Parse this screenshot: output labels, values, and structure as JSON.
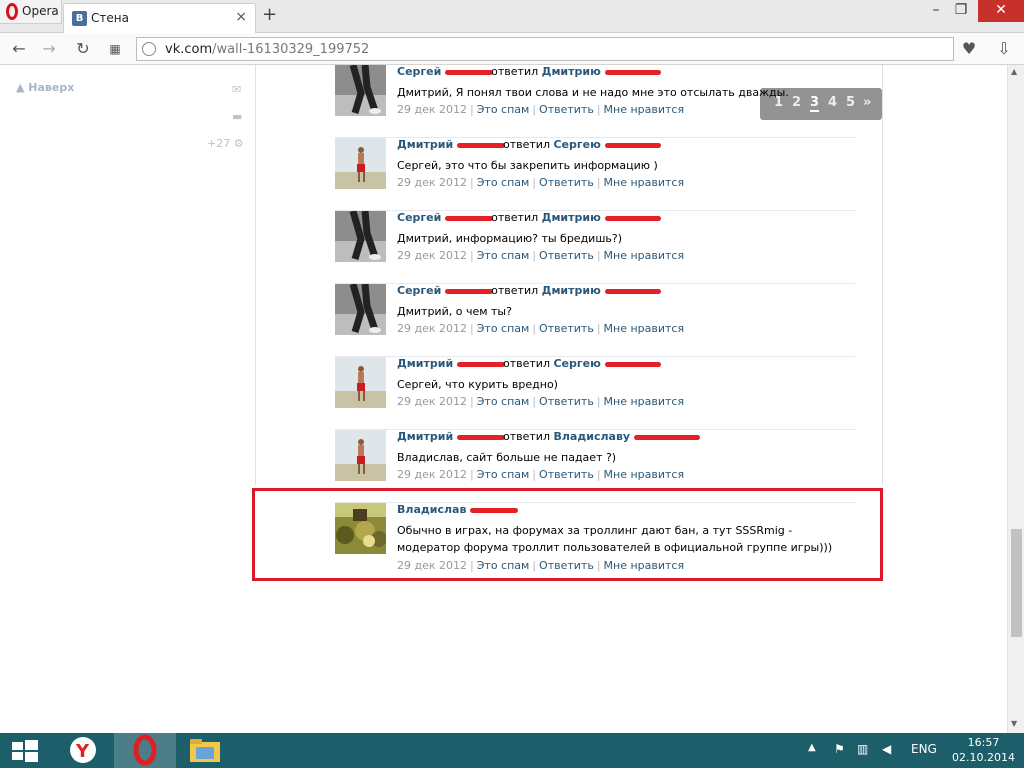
{
  "browser": {
    "app_label": "Opera",
    "tab_title": "Стена",
    "tab_favicon": "В",
    "url_host": "vk.com",
    "url_path": "/wall-16130329_199752"
  },
  "sidebar": {
    "back_to_top": "Наверх",
    "counter": "+27"
  },
  "pager": {
    "pages": [
      "1",
      "2",
      "3",
      "4",
      "5"
    ],
    "current": "3",
    "next": "»"
  },
  "replies": [
    {
      "author": "Сергей",
      "verb": "ответил",
      "target": "Дмитрию",
      "text": "Дмитрий, Я понял твои слова и не надо мне это отсылать дважды.",
      "date": "29 дек 2012",
      "avatar": "runner-bw"
    },
    {
      "author": "Дмитрий",
      "verb": "ответил",
      "target": "Сергею",
      "text": "Сергей, это что бы закрепить информацию )",
      "date": "29 дек 2012",
      "avatar": "beach-man"
    },
    {
      "author": "Сергей",
      "verb": "ответил",
      "target": "Дмитрию",
      "text": "Дмитрий, информацию? ты бредишь?)",
      "date": "29 дек 2012",
      "avatar": "runner-bw"
    },
    {
      "author": "Сергей",
      "verb": "ответил",
      "target": "Дмитрию",
      "text": "Дмитрий, о чем ты?",
      "date": "29 дек 2012",
      "avatar": "runner-bw"
    },
    {
      "author": "Дмитрий",
      "verb": "ответил",
      "target": "Сергею",
      "text": "Сергей, что курить вредно)",
      "date": "29 дек 2012",
      "avatar": "beach-man"
    },
    {
      "author": "Дмитрий",
      "verb": "ответил",
      "target": "Владиславу",
      "text": "Владислав, сайт больше не падает ?)",
      "date": "29 дек 2012",
      "avatar": "beach-man"
    },
    {
      "author": "Владислав",
      "verb": "",
      "target": "",
      "text": "Обычно в играх, на форумах за троллинг дают бан, а тут SSSRmig - модератор форума троллит пользователей в официальной группе игры)))",
      "date": "29 дек 2012",
      "avatar": "crowd-scene"
    }
  ],
  "actions": {
    "spam": "Это спам",
    "reply": "Ответить",
    "like": "Мне нравится"
  },
  "taskbar": {
    "lang": "ENG",
    "time": "16:57",
    "date": "02.10.2014"
  },
  "colors": {
    "vk_link": "#2b587a",
    "highlight": "#d91a2a",
    "taskbar": "#1c5e6a"
  }
}
